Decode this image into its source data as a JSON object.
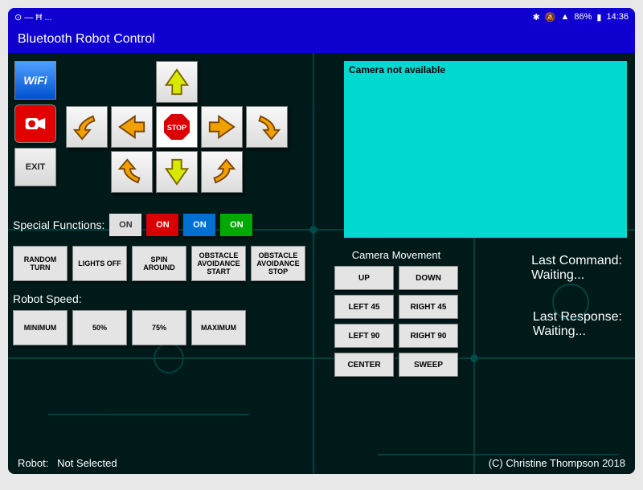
{
  "status": {
    "left": "⊙ — Ħ ...",
    "battery": "86%",
    "time": "14:36"
  },
  "title": "Bluetooth Robot Control",
  "left": {
    "wifi": "WiFi",
    "exit": "EXIT"
  },
  "dpad": {
    "stop": "STOP"
  },
  "camera": {
    "msg": "Camera not available"
  },
  "specials": {
    "label": "Special Functions:",
    "toggles": [
      "ON",
      "ON",
      "ON",
      "ON"
    ]
  },
  "functions": [
    "RANDOM TURN",
    "LIGHTS OFF",
    "SPIN AROUND",
    "OBSTACLE AVOIDANCE START",
    "OBSTACLE AVOIDANCE STOP"
  ],
  "speed": {
    "label": "Robot Speed:",
    "options": [
      "MINIMUM",
      "50%",
      "75%",
      "MAXIMUM"
    ]
  },
  "camMove": {
    "title": "Camera Movement",
    "buttons": [
      "UP",
      "DOWN",
      "LEFT 45",
      "RIGHT 45",
      "LEFT 90",
      "RIGHT 90",
      "CENTER",
      "SWEEP"
    ]
  },
  "last": {
    "cmd_label": "Last Command:",
    "cmd_value": "Waiting...",
    "resp_label": "Last Response:",
    "resp_value": "Waiting..."
  },
  "footer": {
    "robot_label": "Robot:",
    "robot_value": "Not Selected",
    "copyright": "(C) Christine Thompson 2018"
  }
}
